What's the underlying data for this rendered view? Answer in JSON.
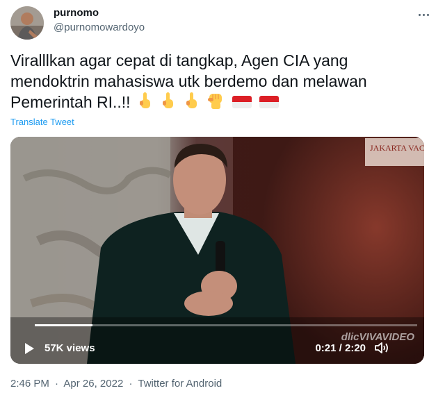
{
  "user": {
    "name": "purnomo",
    "handle": "@purnomowardoyo"
  },
  "tweet": {
    "text": "Viralllkan agar cepat di tangkap, Agen CIA yang mendoktrin mahasiswa utk berdemo dan melawan Pemerintah RI..!!",
    "emojis": [
      "backhand-index-pointing-up",
      "backhand-index-pointing-up",
      "backhand-index-pointing-up",
      "raised-fist",
      "flag-indonesia",
      "flag-indonesia"
    ],
    "translate_label": "Translate Tweet"
  },
  "video": {
    "views": "57K views",
    "time": "0:21 / 2:20",
    "progress": 0.15,
    "watermark": "dlicVIVAVIDEO",
    "corner_sign": "JAKARTA VACUS"
  },
  "meta": {
    "time": "2:46 PM",
    "date": "Apr 26, 2022",
    "source": "Twitter for Android",
    "separator": "·"
  },
  "colors": {
    "link": "#1d9bf0",
    "secondary_text": "#536471"
  },
  "icons": [
    "more-icon",
    "play-icon",
    "volume-icon"
  ]
}
